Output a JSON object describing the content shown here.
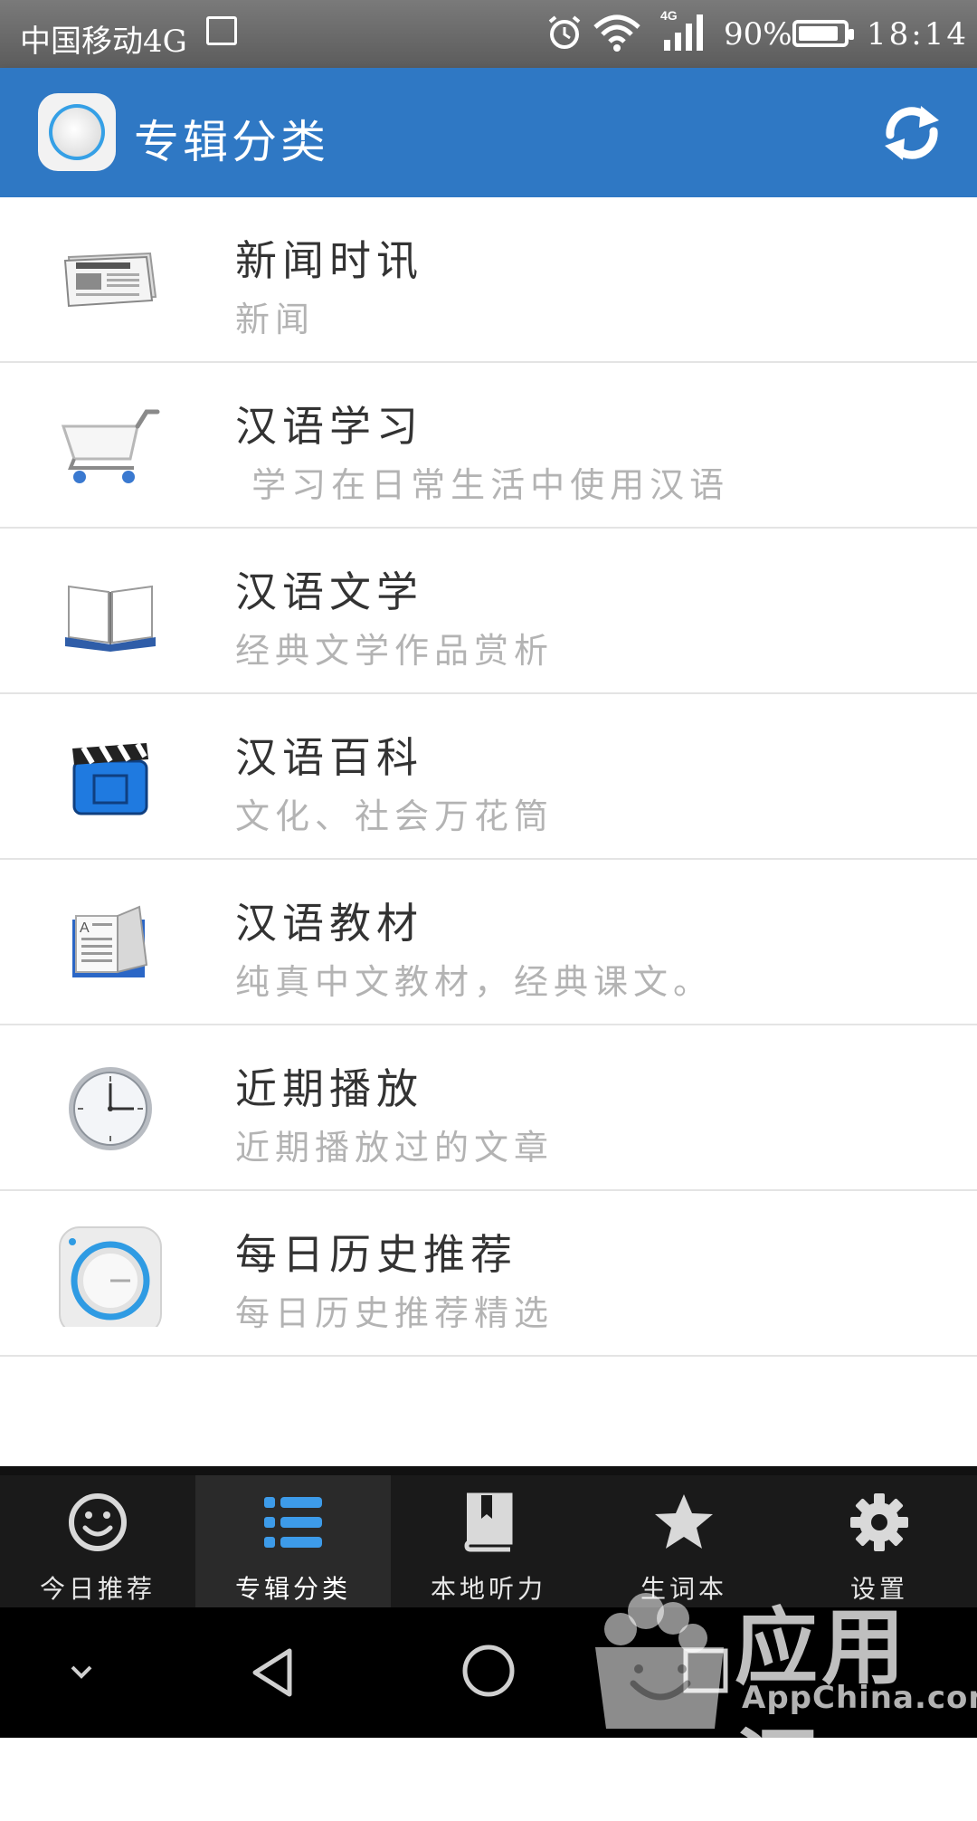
{
  "status_bar": {
    "carrier": "中国移动4G",
    "network_badge": "4G",
    "battery_percent": "90%",
    "battery_level": 0.9,
    "time": "18:14"
  },
  "app_bar": {
    "title": "专辑分类"
  },
  "categories": [
    {
      "title": "新闻时讯",
      "subtitle": "新闻",
      "icon": "newspaper-icon"
    },
    {
      "title": "汉语学习",
      "subtitle": " 学习在日常生活中使用汉语",
      "icon": "shopping-cart-icon"
    },
    {
      "title": "汉语文学",
      "subtitle": "经典文学作品赏析",
      "icon": "open-book-icon"
    },
    {
      "title": "汉语百科",
      "subtitle": "文化、社会万花筒",
      "icon": "clapperboard-icon"
    },
    {
      "title": "汉语教材",
      "subtitle": "纯真中文教材，经典课文。",
      "icon": "textbook-icon"
    },
    {
      "title": "近期播放",
      "subtitle": "近期播放过的文章",
      "icon": "clock-icon"
    },
    {
      "title": "每日历史推荐",
      "subtitle": "每日历史推荐精选",
      "icon": "dial-icon"
    }
  ],
  "tabs": [
    {
      "label": "今日推荐",
      "icon": "smiley-icon",
      "active": false
    },
    {
      "label": "专辑分类",
      "icon": "list-icon",
      "active": true
    },
    {
      "label": "本地听力",
      "icon": "bookmark-book-icon",
      "active": false
    },
    {
      "label": "生词本",
      "icon": "star-icon",
      "active": false
    },
    {
      "label": "设置",
      "icon": "gear-icon",
      "active": false
    }
  ],
  "colors": {
    "app_bar": "#2f78c4",
    "tab_active_indicator": "#2e86d9",
    "tab_bar": "#1a1a1a",
    "subtitle_text": "#b3b3b3"
  },
  "watermark": {
    "text_cn": "应用汇",
    "text_en": "AppChina.com"
  }
}
